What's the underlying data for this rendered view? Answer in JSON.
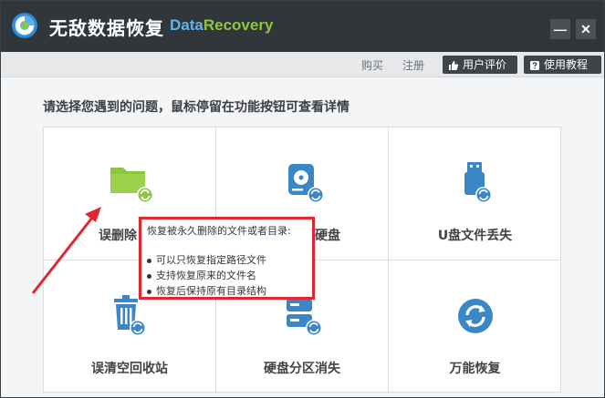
{
  "window": {
    "title": "无敌数据恢复",
    "brand_part1": "Data",
    "brand_part2": "Recovery",
    "minimize_glyph": "—",
    "close_glyph": "✕"
  },
  "toolbar": {
    "buy": "购买",
    "register": "注册",
    "review": "用户评价",
    "tutorial": "使用教程"
  },
  "main": {
    "prompt": "请选择您遇到的问题，鼠标停留在功能按钮可查看详情",
    "cells": [
      {
        "label": "误删除",
        "icon": "folder-recover-icon"
      },
      {
        "label": "硬盘",
        "icon": "harddisk-recover-icon"
      },
      {
        "label": "U盘文件丢失",
        "icon": "usb-recover-icon"
      },
      {
        "label": "误清空回收站",
        "icon": "recycle-bin-recover-icon"
      },
      {
        "label": "硬盘分区消失",
        "icon": "partition-recover-icon"
      },
      {
        "label": "万能恢复",
        "icon": "universal-recover-icon"
      }
    ]
  },
  "tooltip": {
    "title": "恢复被永久删除的文件或者目录:",
    "items": [
      "可以只恢复指定路径文件",
      "支持恢复原来的文件名",
      "恢复后保持原有目录结构"
    ]
  },
  "colors": {
    "titlebar": "#31363b",
    "brand_blue": "#5fb3ea",
    "brand_green": "#8cc63f",
    "icon_green": "#8cc63f",
    "icon_blue": "#3b86c6",
    "highlight_red": "#e0272f"
  }
}
